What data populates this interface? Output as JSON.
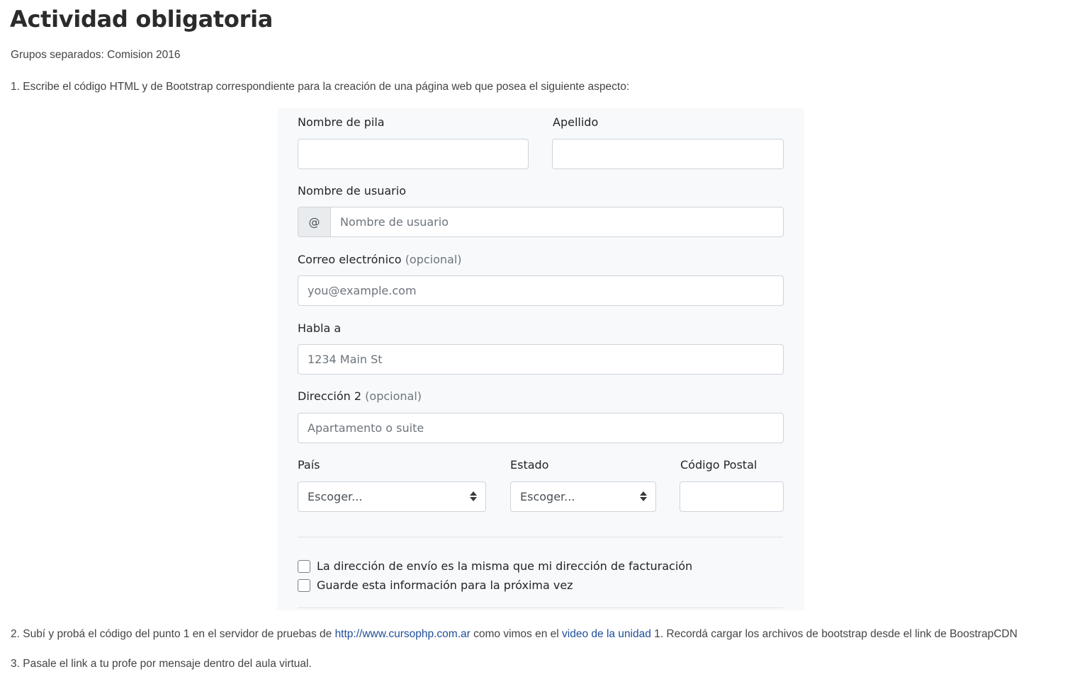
{
  "page": {
    "title": "Actividad obligatoria",
    "groups": "Grupos separados: Comision 2016",
    "item1": "1. Escribe el código HTML y de Bootstrap correspondiente para la creación de una página web que posea el siguiente aspecto:",
    "item2": {
      "before": "2. Subí y probá el código del punto 1 en el servidor de pruebas de ",
      "link1": "http://www.cursophp.com.ar",
      "middle": " como vimos en el ",
      "link2": "video de la unidad",
      "after": " 1. Recordá cargar los archivos de bootstrap desde el link de BoostrapCDN"
    },
    "item3": "3. Pasale el link a tu profe por mensaje dentro del aula virtual."
  },
  "form": {
    "first_name_label": "Nombre de pila",
    "last_name_label": "Apellido",
    "username_label": "Nombre de usuario",
    "username_addon": "@",
    "username_placeholder": "Nombre de usuario",
    "email_label": "Correo electrónico",
    "email_optional": "(opcional)",
    "email_placeholder": "you@example.com",
    "address_label": "Habla a",
    "address_placeholder": "1234 Main St",
    "address2_label": "Dirección 2",
    "address2_optional": "(opcional)",
    "address2_placeholder": "Apartamento o suite",
    "country_label": "País",
    "country_value": "Escoger...",
    "state_label": "Estado",
    "state_value": "Escoger...",
    "zip_label": "Código Postal",
    "checkbox_same_address": "La dirección de envío es la misma que mi dirección de facturación",
    "checkbox_save_info": "Guarde esta información para la próxima vez"
  },
  "colors": {
    "link": "#1f4e9a",
    "form_background": "#f8f9fa",
    "input_border": "#ced4da",
    "muted_text": "#6c757d"
  }
}
